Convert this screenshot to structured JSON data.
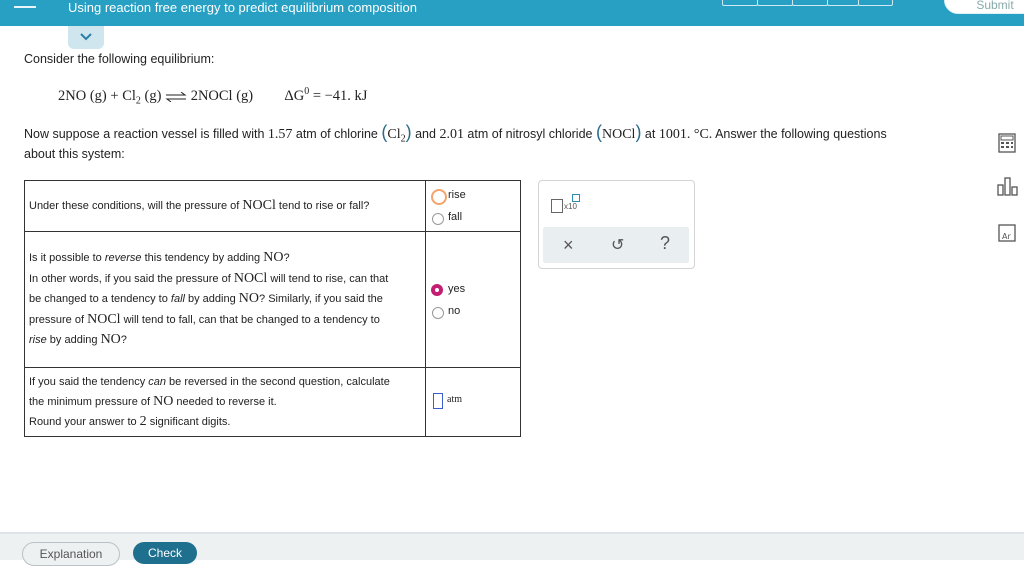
{
  "header": {
    "title": "Using reaction free energy to predict equilibrium composition",
    "submit_label": "Submit"
  },
  "problem": {
    "intro": "Consider the following equilibrium:",
    "equation": {
      "lhs_a": "2NO",
      "state_g": "(g)",
      "plus": "+",
      "cl": "Cl",
      "sub2": "2",
      "rhs": "2NOCl",
      "delta_g_label": "ΔG",
      "delta_g_sup": "0",
      "delta_g_value": "= −41. kJ"
    },
    "setup_1": "Now suppose a reaction vessel is filled with",
    "p_cl2": "1.57",
    "unit_atm": "atm",
    "of_chlorine": "of chlorine",
    "cl2_name": "Cl",
    "and": "and",
    "p_nocl": "2.01",
    "of_nitrosyl": "of nitrosyl chloride",
    "nocl": "NOCl",
    "at": "at",
    "temp": "1001. °C.",
    "answer_tail": "Answer the following questions",
    "about": "about this system:"
  },
  "questions": {
    "q1": {
      "text_a": "Under these conditions, will the pressure of ",
      "species": "NOCl",
      "text_b": " tend to rise or fall?",
      "options": [
        "rise",
        "fall"
      ]
    },
    "q2": {
      "line1_a": "Is it possible to ",
      "line1_em": "reverse",
      "line1_b": " this tendency by adding ",
      "no": "NO",
      "q": "?",
      "line2_a": "In other words, if you said the pressure of ",
      "nocl": "NOCl",
      "line2_b": " will tend to rise, can that",
      "line3_a": "be changed to a tendency to ",
      "fall": "fall",
      "line3_b": " by adding ",
      "line3_c": "? Similarly, if you said the",
      "line4_a": "pressure of ",
      "line4_b": " will tend to fall, can that be changed to a tendency to",
      "rise": "rise",
      "line5_b": " by adding ",
      "options": [
        "yes",
        "no"
      ]
    },
    "q3": {
      "line1_a": "If you said the tendency ",
      "can": "can",
      "line1_b": " be reversed in the second question, calculate",
      "line2_a": "the minimum pressure of ",
      "no": "NO",
      "line2_b": " needed to reverse it.",
      "line3_a": "Round your answer to ",
      "digits": "2",
      "line3_b": " significant digits.",
      "unit": "atm",
      "value": ""
    }
  },
  "tools": {
    "x10_label": "x10",
    "close": "×",
    "undo": "↺",
    "help": "?"
  },
  "footer": {
    "explanation_label": "Explanation",
    "check_label": "Check"
  },
  "colors": {
    "header_bg": "#27a0c4",
    "selected_radio": "#c41e73",
    "highlight_radio": "#f3a46c",
    "input_border": "#3a5fcd"
  }
}
